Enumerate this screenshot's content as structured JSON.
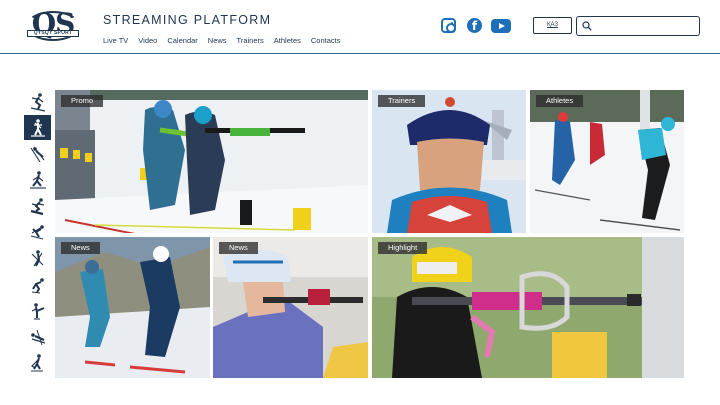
{
  "logo": {
    "letters": "QS",
    "band": "QYSQY SPORT"
  },
  "brand": {
    "title": "STREAMING PLATFORM"
  },
  "nav": [
    "Live TV",
    "Video",
    "Calendar",
    "News",
    "Trainers",
    "Athletes",
    "Contacts"
  ],
  "social": [
    "instagram-icon",
    "facebook-icon",
    "youtube-icon"
  ],
  "language": {
    "label": "ҚАЗ"
  },
  "search": {
    "placeholder": "",
    "value": ""
  },
  "sidebar": {
    "active_index": 1,
    "sports": [
      "alpine-skier",
      "biathlete",
      "ski-jumper",
      "cross-country-skier",
      "snowboarder",
      "freestyle-skier",
      "nordic-combined",
      "speed-skater",
      "figure-skater",
      "skeleton-rider",
      "hockey-player"
    ]
  },
  "tiles": [
    {
      "label": "Promo"
    },
    {
      "label": "Trainers"
    },
    {
      "label": "Athletes"
    },
    {
      "label": "News"
    },
    {
      "label": "News"
    },
    {
      "label": "Highlight"
    }
  ],
  "colors": {
    "primary": "#1f3550",
    "accent": "#1f6fb8",
    "tag_bg": "#2d2d2d"
  }
}
